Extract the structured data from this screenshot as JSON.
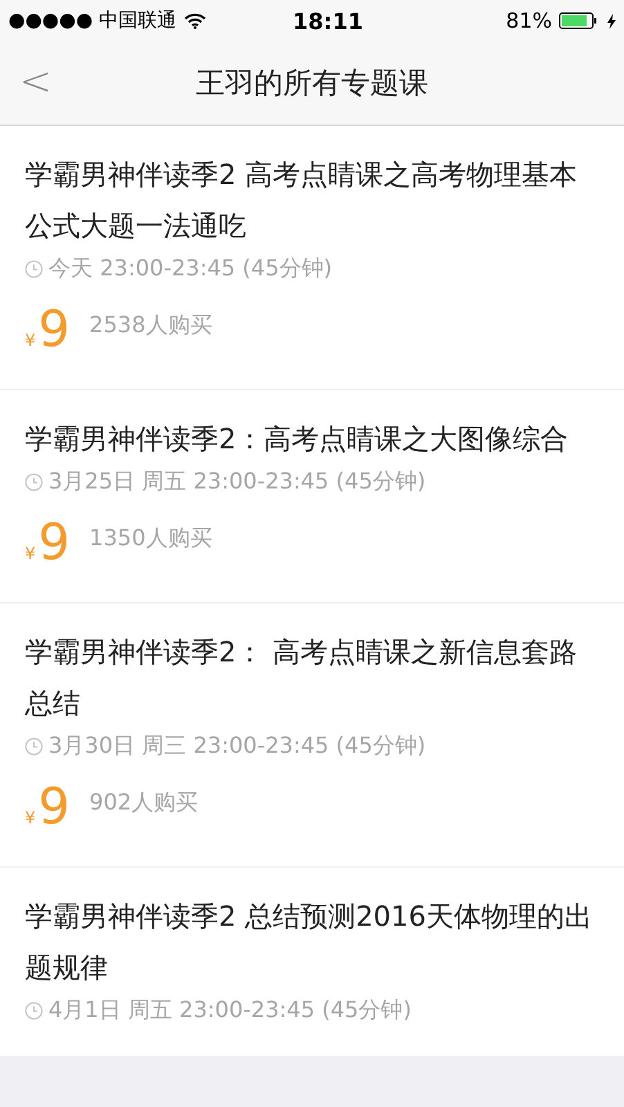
{
  "status_bar": {
    "carrier": "●●●●● 中国联通",
    "time": "18:11",
    "battery": "81%"
  },
  "nav": {
    "back": "<",
    "title": "王羽的所有专题课"
  },
  "courses": [
    {
      "title": "学霸男神伴读季2 高考点睛课之高考物理基本公式大题一法通吃",
      "time": "今天 23:00-23:45 (45分钟)",
      "currency": "¥",
      "price": "9",
      "buyers": "2538人购买"
    },
    {
      "title": "学霸男神伴读季2：高考点睛课之大图像综合",
      "time": "3月25日 周五 23:00-23:45 (45分钟)",
      "currency": "¥",
      "price": "9",
      "buyers": "1350人购买"
    },
    {
      "title": "学霸男神伴读季2： 高考点睛课之新信息套路总结",
      "time": "3月30日 周三 23:00-23:45 (45分钟)",
      "currency": "¥",
      "price": "9",
      "buyers": "902人购买"
    },
    {
      "title": "学霸男神伴读季2 总结预测2016天体物理的出题规律",
      "time": "4月1日 周五 23:00-23:45 (45分钟)"
    }
  ]
}
